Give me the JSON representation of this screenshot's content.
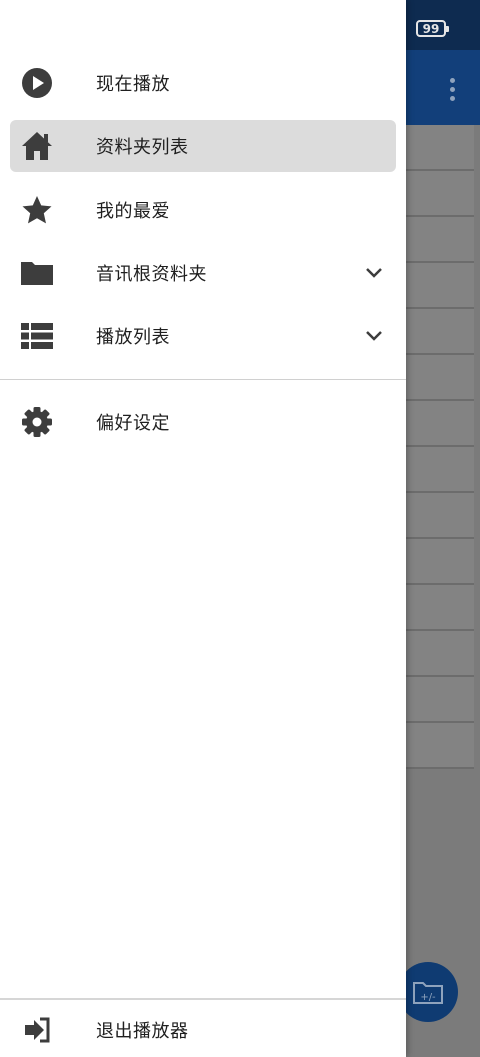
{
  "status": {
    "battery_level": "99"
  },
  "drawer": {
    "items": [
      {
        "label": "现在播放",
        "icon": "play-circle-icon"
      },
      {
        "label": "资料夹列表",
        "icon": "home-icon",
        "selected": true
      },
      {
        "label": "我的最爱",
        "icon": "star-icon"
      },
      {
        "label": "音讯根资料夹",
        "icon": "folder-icon",
        "expandable": true
      },
      {
        "label": "播放列表",
        "icon": "list-icon",
        "expandable": true
      }
    ],
    "settings": {
      "label": "偏好设定",
      "icon": "gear-icon"
    },
    "exit": {
      "label": "退出播放器",
      "icon": "exit-icon"
    }
  },
  "fab": {
    "label": "+/-",
    "icon": "folder-plus-minus-icon"
  },
  "colors": {
    "status_bar": "#0e2b50",
    "app_bar": "#123f7a",
    "selected_item": "#dcdcdc",
    "icon": "#3d3d3d"
  }
}
